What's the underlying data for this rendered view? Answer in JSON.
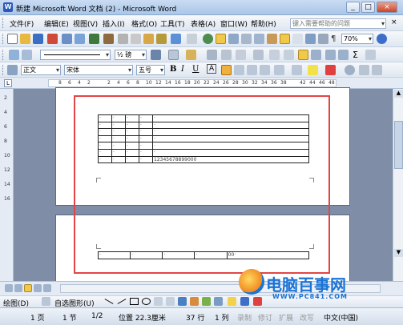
{
  "window": {
    "title": "新建 Microsoft Word 文档 (2) - Microsoft Word",
    "minimize": "_",
    "maximize": "□",
    "close": "×"
  },
  "menu": {
    "items": [
      "文件(F)",
      "编辑(E)",
      "视图(V)",
      "插入(I)",
      "格式(O)",
      "工具(T)",
      "表格(A)",
      "窗口(W)",
      "帮助(H)"
    ],
    "help_placeholder": "键入需要帮助的问题"
  },
  "toolbar": {
    "zoom": "70%",
    "font_size_label": "½ 磅"
  },
  "format": {
    "style": "正文",
    "font": "宋体",
    "size": "五号",
    "bold": "B",
    "italic": "I",
    "underline": "U",
    "char_a": "A"
  },
  "ruler": {
    "ticks": [
      "8",
      "6",
      "4",
      "2",
      "2",
      "4",
      "6",
      "8",
      "10",
      "12",
      "14",
      "16",
      "18",
      "20",
      "22",
      "24",
      "26",
      "28",
      "30",
      "32",
      "34",
      "36",
      "38",
      "42",
      "44",
      "46",
      "48"
    ],
    "vticks": [
      "2",
      "4",
      "6",
      "8",
      "10",
      "12",
      "14",
      "16"
    ]
  },
  "document": {
    "table_rows": [
      [
        "·",
        "·",
        "·",
        "·",
        "·"
      ],
      [
        "·",
        "·",
        "·",
        "·",
        "·"
      ],
      [
        "·",
        "·",
        "·",
        "·",
        "·"
      ],
      [
        "·",
        "·",
        "·",
        "·",
        "·"
      ],
      [
        "·",
        "·",
        "·",
        "·",
        "·"
      ],
      [
        "·",
        "·",
        "·",
        "·",
        "·"
      ],
      [
        "·",
        "·",
        "·",
        "·",
        "12345678899000"
      ]
    ],
    "bottom_row": [
      "·",
      "·",
      "·",
      "·",
      "00·"
    ]
  },
  "drawbar": {
    "draw_label": "绘图(D)",
    "autoshapes": "自选图形(U)"
  },
  "status": {
    "page": "1 页",
    "section": "1 节",
    "pages": "1/2",
    "position": "位置 22.3厘米",
    "line": "37 行",
    "column": "1 列",
    "rec": "录制",
    "track": "修订",
    "ext": "扩展",
    "ovr": "改写",
    "lang": "中文(中国)"
  },
  "watermark": {
    "brand": "电脑百事网",
    "url": "WWW.PC841.COM"
  },
  "colors": {
    "highlight_box": "#e24545",
    "canvas": "#7f8ea6",
    "brand_blue": "#1a73d6"
  }
}
